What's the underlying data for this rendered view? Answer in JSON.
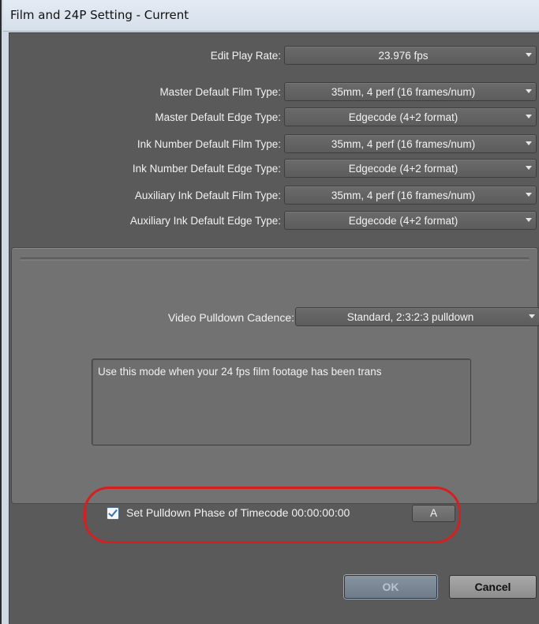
{
  "window": {
    "title": "Film and 24P Setting - Current"
  },
  "settings": [
    {
      "label": "Edit Play Rate:",
      "value": "23.976 fps"
    },
    {
      "label": "Master Default Film Type:",
      "value": "35mm, 4 perf (16 frames/num)"
    },
    {
      "label": "Master Default Edge Type:",
      "value": "Edgecode (4+2 format)"
    },
    {
      "label": "Ink Number Default Film Type:",
      "value": "35mm, 4 perf (16 frames/num)"
    },
    {
      "label": "Ink Number Default Edge Type:",
      "value": "Edgecode (4+2 format)"
    },
    {
      "label": "Auxiliary Ink Default Film Type:",
      "value": "35mm, 4 perf (16 frames/num)"
    },
    {
      "label": "Auxiliary Ink Default Edge Type:",
      "value": "Edgecode (4+2 format)"
    }
  ],
  "pulldown": {
    "label": "Video Pulldown Cadence:",
    "value": "Standard, 2:3:2:3 pulldown",
    "description": "Use this mode when your 24 fps film footage has been trans"
  },
  "phase": {
    "checked": true,
    "label": "Set Pulldown Phase of Timecode 00:00:00:00",
    "button_label": "A"
  },
  "buttons": {
    "ok": "OK",
    "cancel": "Cancel"
  },
  "colors": {
    "panel": "#5a5a5a",
    "subpanel": "#727272",
    "highlight": "#d42020",
    "text": "#f2f2f2"
  },
  "icons": [
    "dropdown-arrow-icon",
    "checkmark-icon"
  ]
}
